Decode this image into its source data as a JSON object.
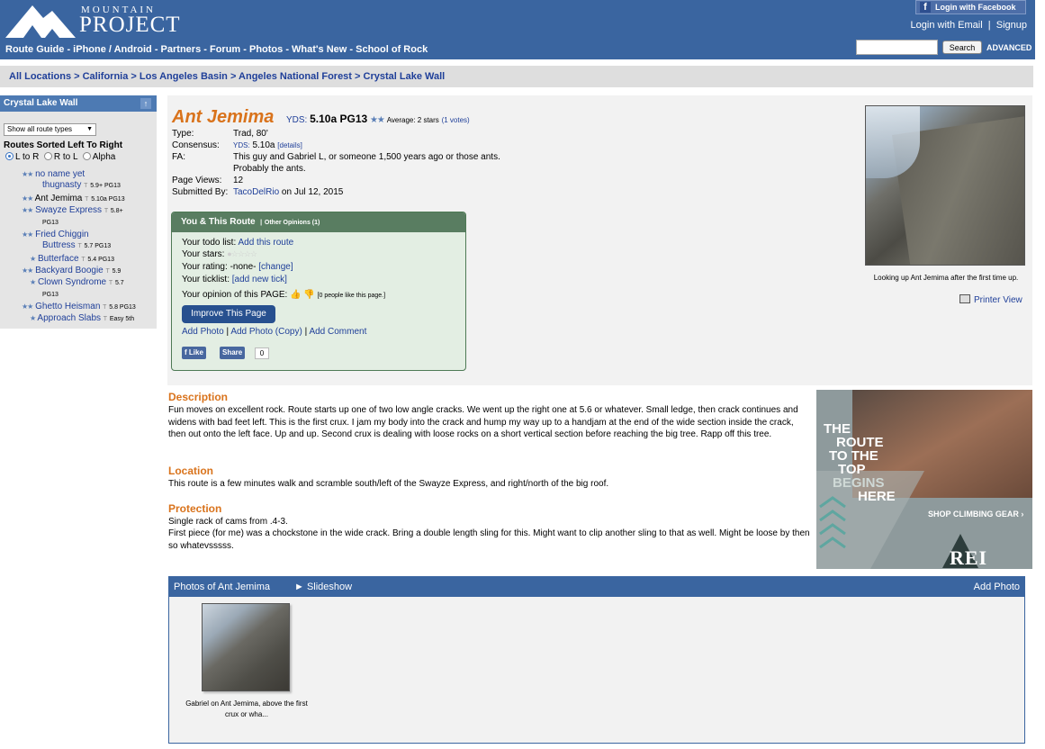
{
  "header": {
    "logo_top": "MOUNTAIN",
    "logo_bottom": "PROJECT",
    "nav": [
      "Route Guide",
      "iPhone / Android",
      "Partners",
      "Forum",
      "Photos",
      "What's New",
      "School of Rock"
    ],
    "facebook_login": "Login with Facebook",
    "login_email": "Login with Email",
    "signup": "Signup",
    "search_value": "",
    "search_button": "Search",
    "advanced": "ADVANCED"
  },
  "breadcrumb": [
    "All Locations",
    "California",
    "Los Angeles Basin",
    "Angeles National Forest",
    "Crystal Lake Wall"
  ],
  "sidebar": {
    "title": "Crystal Lake Wall",
    "up_icon": "arrow-up-icon",
    "filter_value": "Show all route types",
    "sorted_heading": "Routes Sorted Left To Right",
    "sort_options": [
      "L to R",
      "R to L",
      "Alpha"
    ],
    "sort_selected": 0,
    "routes": [
      {
        "stars": "★★",
        "name": "no name yet",
        "name2": "thugnasty",
        "type": "T",
        "grade": "5.9+ PG13"
      },
      {
        "stars": "★★",
        "name": "Ant Jemima",
        "type": "T",
        "grade": "5.10a PG13"
      },
      {
        "stars": "★★",
        "name": "Swayze Express",
        "type": "T",
        "grade": "5.8+",
        "grade2": "PG13"
      },
      {
        "stars": "★★",
        "name": "Fried Chiggin",
        "name2": "Buttress",
        "type": "T",
        "grade": "5.7 PG13"
      },
      {
        "stars": "★",
        "name": "Butterface",
        "type": "T",
        "grade": "5.4 PG13"
      },
      {
        "stars": "★★",
        "name": "Backyard Boogie",
        "type": "T",
        "grade": "5.9"
      },
      {
        "stars": "★",
        "name": "Clown Syndrome",
        "type": "T",
        "grade": "5.7",
        "grade2": "PG13"
      },
      {
        "stars": "★★",
        "name": "Ghetto Heisman",
        "type": "T",
        "grade": "5.8 PG13"
      },
      {
        "stars": "★",
        "name": "Approach Slabs",
        "type": "T",
        "grade": "Easy 5th"
      }
    ]
  },
  "route": {
    "title": "Ant Jemima",
    "yds_label": "YDS:",
    "grade": "5.10a PG13",
    "rating_stars": "★★",
    "average": "Average: 2 stars",
    "votes": "(1 votes)",
    "info": [
      {
        "key": "Type:",
        "value": "Trad, 80'"
      },
      {
        "key": "Consensus:",
        "value": "5.10a",
        "prefix": "YDS:",
        "link": "[details]"
      },
      {
        "key": "FA:",
        "value": "This guy and Gabriel L, or someone 1,500 years ago or those ants.",
        "value2": "Probably the ants."
      },
      {
        "key": "Page Views:",
        "value": "12"
      },
      {
        "key": "Submitted By:",
        "value": "TacoDelRio",
        "suffix": "on Jul 12, 2015"
      }
    ]
  },
  "you_route": {
    "title": "You & This Route",
    "sep": "|",
    "other_opinions": "Other Opinions (1)",
    "todo_label": "Your todo list:",
    "todo_link": "Add this route",
    "stars_label": "Your stars:",
    "rating_label": "Your rating:",
    "rating_value": "-none-",
    "rating_change": "[change]",
    "ticklist_label": "Your ticklist:",
    "ticklist_link": "[add new tick]",
    "opinion_label": "Your opinion of this PAGE:",
    "opinion_count": "[0 people like this page.]",
    "improve_button": "Improve This Page",
    "add_photo": "Add Photo",
    "add_photo_copy": "Add Photo (Copy)",
    "add_comment": "Add Comment",
    "fb_like": "Like",
    "fb_share": "Share",
    "share_count": "0"
  },
  "photo": {
    "caption": "Looking up Ant Jemima after the first time up.",
    "printer_view": "Printer View"
  },
  "description": {
    "heading": "Description",
    "text": "Fun moves on excellent rock. Route starts up one of two low angle cracks. We went up the right one at 5.6 or whatever. Small ledge, then crack continues and widens with bad feet left. This is the first crux. I jam my body into the crack and hump my way up to a handjam at the end of the wide section inside the crack, then out onto the left face. Up and up. Second crux is dealing with loose rocks on a short vertical section before reaching the big tree. Rapp off this tree."
  },
  "location": {
    "heading": "Location",
    "text": "This route is a few minutes walk and scramble south/left of the Swayze Express, and right/north of the big roof."
  },
  "protection": {
    "heading": "Protection",
    "line1": "Single rack of cams from .4-3.",
    "line2": "First piece (for me) was a chockstone in the wide crack. Bring a double length sling for this. Might want to clip another sling to that as well. Might be loose by then so whatevsssss."
  },
  "ad": {
    "line1": "THE",
    "line2": "ROUTE",
    "line3": "TO THE",
    "line4": "TOP",
    "line5": "BEGINS",
    "line6": "HERE",
    "shop": "SHOP CLIMBING GEAR ›",
    "brand": "REI"
  },
  "photos_section": {
    "title": "Photos of Ant Jemima",
    "slideshow": "► Slideshow",
    "add_photo": "Add Photo",
    "thumb_caption_1": "Gabriel on Ant Jemima, above the first",
    "thumb_caption_2": "crux or wha..."
  },
  "colors": {
    "header_blue": "#3a65a0",
    "title_orange": "#d9731c",
    "link_blue": "#1f3f99",
    "panel_green": "#597d61"
  }
}
